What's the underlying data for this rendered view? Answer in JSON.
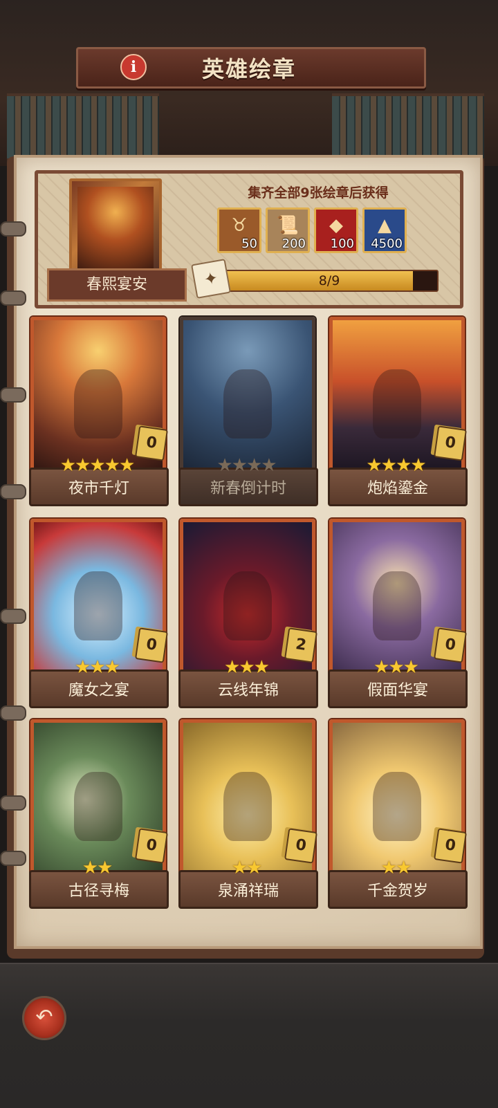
{
  "header": {
    "title": "英雄绘章",
    "info_icon": "info-icon"
  },
  "album": {
    "name": "春熙宴安",
    "reward_heading": "集齐全部9张绘章后获得",
    "rewards": [
      {
        "icon": "horn-emblem-icon",
        "qty": "50",
        "color": "#9a5a2a"
      },
      {
        "icon": "scroll-icon",
        "qty": "200",
        "color": "#a8845a"
      },
      {
        "icon": "red-gem-icon",
        "qty": "100",
        "color": "#a8201e"
      },
      {
        "icon": "ore-pile-icon",
        "qty": "4500",
        "color": "#2a4a8a"
      }
    ],
    "progress_text": "8/9",
    "progress_fraction": 0.889
  },
  "cards": [
    {
      "name": "夜市千灯",
      "stars": "★★★★★",
      "count": "0",
      "owned": true
    },
    {
      "name": "新春倒计时",
      "stars": "★★★★",
      "count": "",
      "owned": false
    },
    {
      "name": "炮焰鎏金",
      "stars": "★★★★",
      "count": "0",
      "owned": true
    },
    {
      "name": "魔女之宴",
      "stars": "★★★",
      "count": "0",
      "owned": true
    },
    {
      "name": "云线年锦",
      "stars": "★★★",
      "count": "2",
      "owned": true
    },
    {
      "name": "假面华宴",
      "stars": "★★★",
      "count": "0",
      "owned": true
    },
    {
      "name": "古径寻梅",
      "stars": "★★",
      "count": "0",
      "owned": true
    },
    {
      "name": "泉涌祥瑞",
      "stars": "★★",
      "count": "0",
      "owned": true
    },
    {
      "name": "千金贺岁",
      "stars": "★★",
      "count": "0",
      "owned": true
    }
  ],
  "footer": {
    "back_icon": "back-arrow-icon"
  }
}
